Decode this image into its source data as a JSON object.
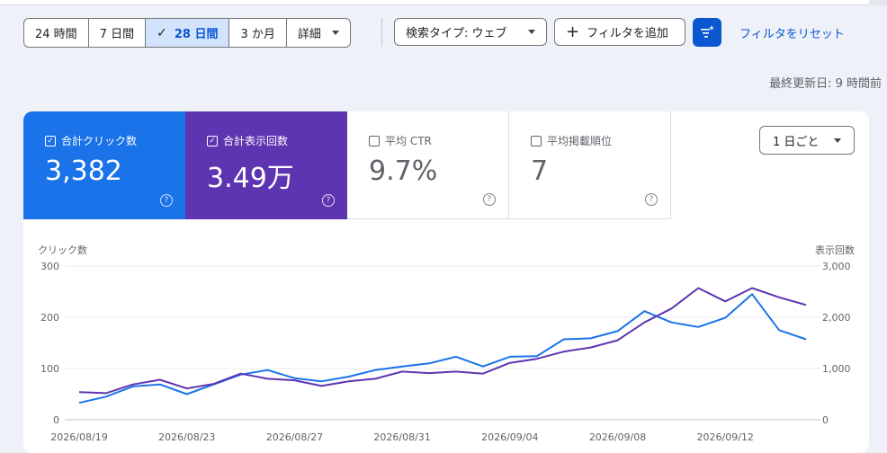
{
  "filters": {
    "date_ranges": [
      {
        "label": "24 時間",
        "active": false
      },
      {
        "label": "7 日間",
        "active": false
      },
      {
        "label": "28 日間",
        "active": true
      },
      {
        "label": "3 か月",
        "active": false
      }
    ],
    "details_label": "詳細",
    "search_type_label": "検索タイプ: ウェブ",
    "add_filter_label": "フィルタを追加",
    "reset_label": "フィルタをリセット"
  },
  "last_updated": "最終更新日: 9 時間前",
  "metrics": [
    {
      "label": "合計クリック数",
      "value": "3,382",
      "checked": true,
      "color": "#1a73e8"
    },
    {
      "label": "合計表示回数",
      "value": "3.49万",
      "checked": true,
      "color": "#5e35b1"
    },
    {
      "label": "平均 CTR",
      "value": "9.7%",
      "checked": false
    },
    {
      "label": "平均掲載順位",
      "value": "7",
      "checked": false
    }
  ],
  "period_select": "1 日ごと",
  "chart_data": {
    "type": "line",
    "ylabel": "クリック数",
    "y2label": "表示回数",
    "ylim": [
      0,
      300
    ],
    "y2lim": [
      0,
      3000
    ],
    "yticks": [
      "0",
      "100",
      "200",
      "300"
    ],
    "y2ticks": [
      "0",
      "1,000",
      "2,000",
      "3,000"
    ],
    "xtick_labels": [
      "2026/08/19",
      "2026/08/23",
      "2026/08/27",
      "2026/08/31",
      "2026/09/04",
      "2026/09/08",
      "2026/09/12"
    ],
    "x": [
      "2026/08/19",
      "2026/08/20",
      "2026/08/21",
      "2026/08/22",
      "2026/08/23",
      "2026/08/24",
      "2026/08/25",
      "2026/08/26",
      "2026/08/27",
      "2026/08/28",
      "2026/08/29",
      "2026/08/30",
      "2026/08/31",
      "2026/09/01",
      "2026/09/02",
      "2026/09/03",
      "2026/09/04",
      "2026/09/05",
      "2026/09/06",
      "2026/09/07",
      "2026/09/08",
      "2026/09/09",
      "2026/09/10",
      "2026/09/11",
      "2026/09/12",
      "2026/09/13",
      "2026/09/14",
      "2026/09/15"
    ],
    "series": [
      {
        "axis": "left",
        "color": "#1a73e8",
        "values": [
          33,
          45,
          65,
          69,
          50,
          69,
          88,
          97,
          81,
          75,
          84,
          97,
          104,
          110,
          123,
          104,
          123,
          124,
          157,
          159,
          173,
          212,
          190,
          181,
          199,
          245,
          175,
          157
        ]
      },
      {
        "axis": "right",
        "color": "#5e35b1",
        "values": [
          540,
          520,
          690,
          780,
          610,
          700,
          900,
          800,
          770,
          660,
          750,
          800,
          940,
          910,
          940,
          900,
          1110,
          1190,
          1330,
          1410,
          1550,
          1900,
          2170,
          2570,
          2310,
          2570,
          2390,
          2240
        ]
      }
    ]
  }
}
